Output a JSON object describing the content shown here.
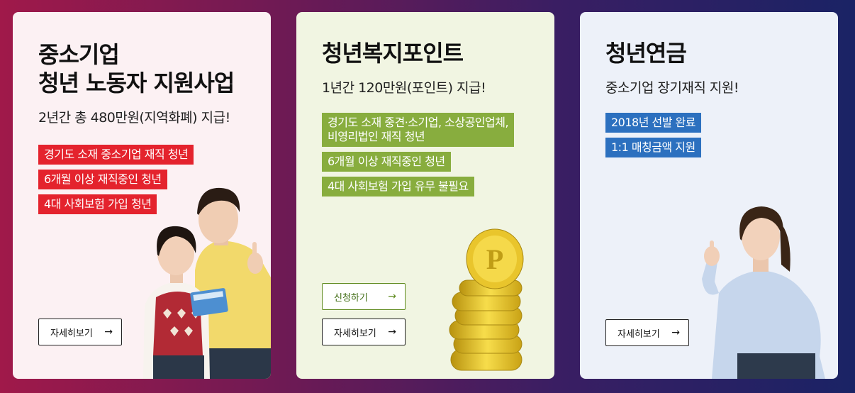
{
  "cards": [
    {
      "title": "중소기업\n청년 노동자 지원사업",
      "subtitle": "2년간 총 480만원(지역화폐) 지급!",
      "tags": [
        "경기도 소재 중소기업 재직 청년",
        "6개월 이상 재직중인 청년",
        "4대 사회보험 가입 청년"
      ],
      "more_label": "자세히보기",
      "arrow": "→"
    },
    {
      "title": "청년복지포인트",
      "subtitle": "1년간 120만원(포인트) 지급!",
      "tags": [
        "경기도 소재  중견·소기업, 소상공인업체,\n비영리법인 재직 청년",
        "6개월 이상 재직중인 청년",
        "4대 사회보험 가입 유무 불필요"
      ],
      "apply_label": "신청하기",
      "more_label": "자세히보기",
      "arrow": "→"
    },
    {
      "title": "청년연금",
      "subtitle": "중소기업 장기재직 지원!",
      "tags": [
        "2018년 선발 완료",
        "1:1 매칭금액 지원"
      ],
      "more_label": "자세히보기",
      "arrow": "→"
    }
  ],
  "coin_letter": "P",
  "colors": {
    "tag_red": "#e4232d",
    "tag_green": "#88ad3e",
    "tag_blue": "#2c70bf"
  }
}
